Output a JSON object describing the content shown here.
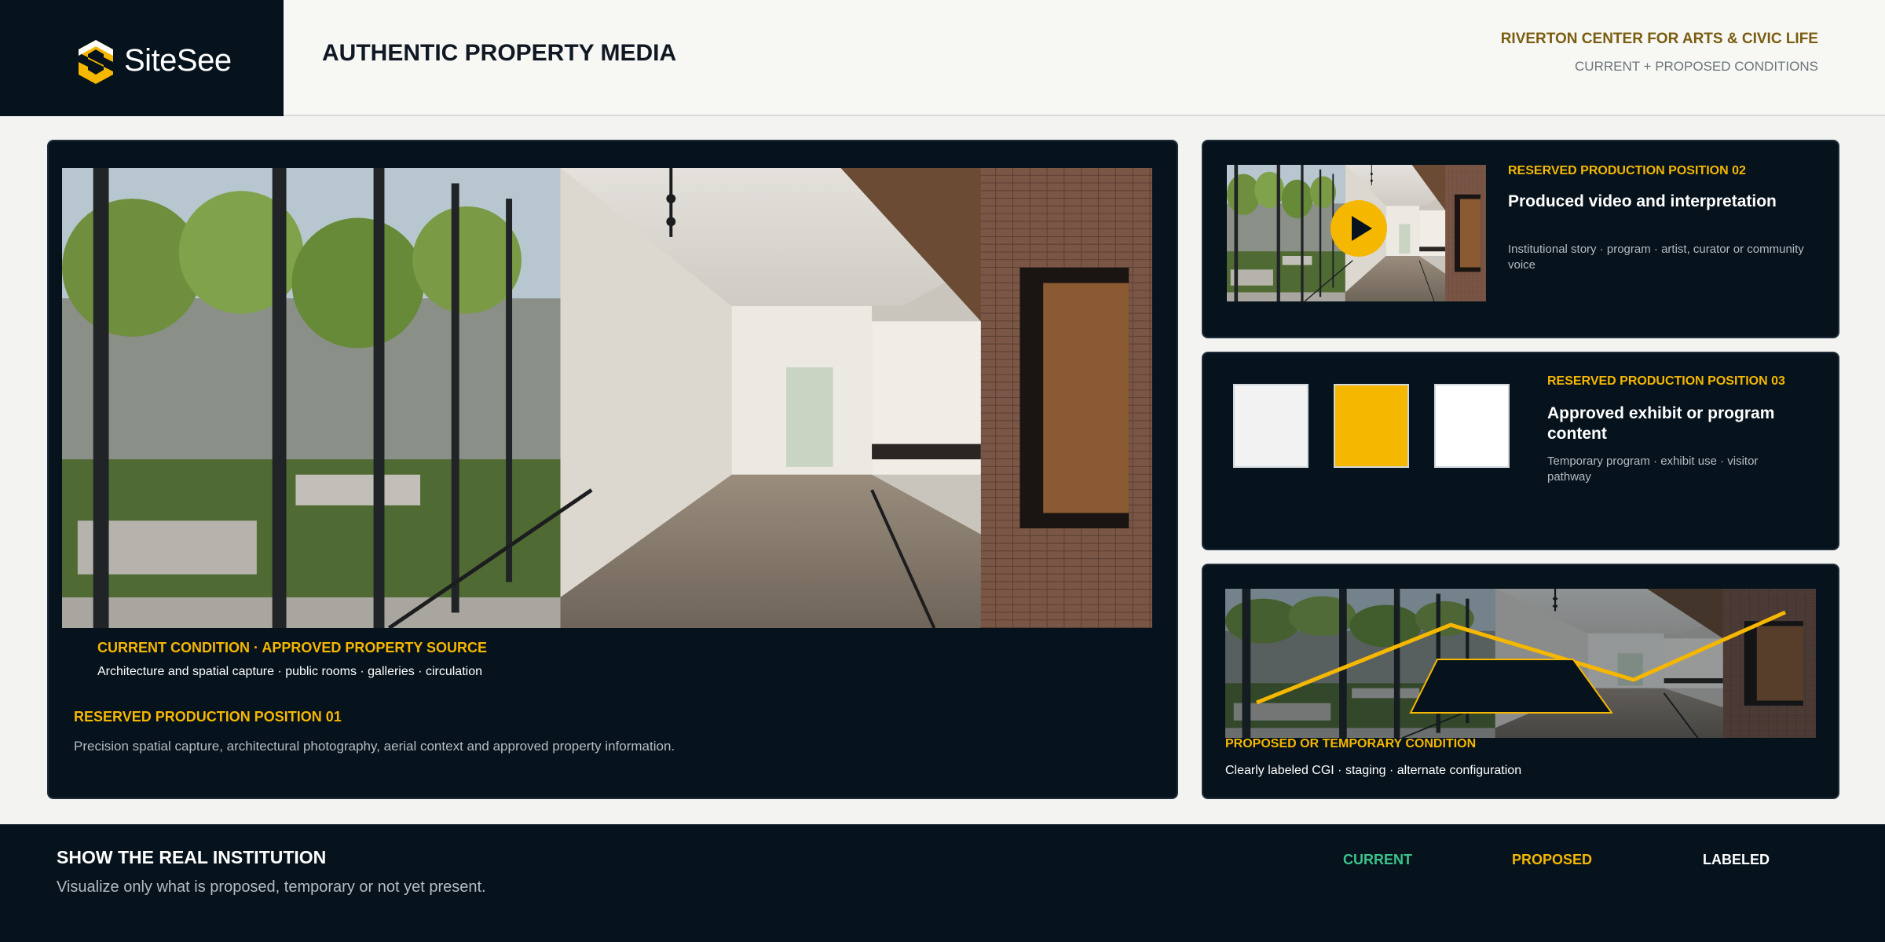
{
  "brand": {
    "name": "SiteSee",
    "logo_icon": "sitesee-logo-icon",
    "accent": "#f5b700"
  },
  "header": {
    "title": "AUTHENTIC PROPERTY MEDIA",
    "institution": "RIVERTON CENTER FOR ARTS & CIVIC LIFE",
    "subtitle": "CURRENT + PROPOSED CONDITIONS"
  },
  "main_panel": {
    "caption_title": "CURRENT CONDITION · APPROVED PROPERTY SOURCE",
    "caption_sub": "Architecture and spatial capture · public rooms · galleries · circulation",
    "reserved_title": "RESERVED PRODUCTION POSITION 01",
    "reserved_desc": "Precision spatial capture, architectural photography, aerial context and approved property information."
  },
  "panel_video": {
    "tag": "RESERVED PRODUCTION POSITION 02",
    "heading": "Produced video and interpretation",
    "desc": "Institutional story · program · artist, curator or community voice",
    "icon": "play-icon"
  },
  "panel_exhibit": {
    "tag": "RESERVED PRODUCTION POSITION 03",
    "heading": "Approved exhibit or program content",
    "desc": "Temporary program · exhibit use · visitor pathway",
    "swatches": [
      "#f2f2f2",
      "#f5b700",
      "#ffffff"
    ]
  },
  "panel_proposed": {
    "tag": "PROPOSED OR TEMPORARY CONDITION",
    "desc": "Clearly labeled CGI · staging · alternate configuration"
  },
  "footer": {
    "title": "SHOW THE REAL INSTITUTION",
    "subtitle": "Visualize only what is proposed, temporary or not yet present.",
    "legend": [
      {
        "label": "CURRENT",
        "color": "#3cc38c"
      },
      {
        "label": "PROPOSED",
        "color": "#f5b700"
      },
      {
        "label": "LABELED",
        "color": "#ffffff"
      }
    ]
  }
}
